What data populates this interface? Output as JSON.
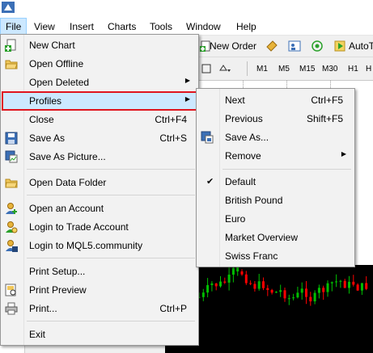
{
  "menubar": {
    "items": [
      {
        "label": "File",
        "active": true
      },
      {
        "label": "View"
      },
      {
        "label": "Insert"
      },
      {
        "label": "Charts"
      },
      {
        "label": "Tools"
      },
      {
        "label": "Window"
      },
      {
        "label": "Help"
      }
    ]
  },
  "toolbar": {
    "new_order_label": "New Order",
    "autotrading_label": "AutoT",
    "timeframes": [
      "M1",
      "M5",
      "M15",
      "M30",
      "H1",
      "H"
    ]
  },
  "file_menu": {
    "items": [
      {
        "label": "New Chart",
        "shortcut": "",
        "icon": "new-chart-icon"
      },
      {
        "label": "Open Offline",
        "shortcut": "",
        "icon": "open-folder-icon"
      },
      {
        "label": "Open Deleted",
        "shortcut": "",
        "submenu": true
      },
      {
        "label": "Profiles",
        "shortcut": "",
        "submenu": true,
        "highlighted": true
      },
      {
        "label": "Close",
        "shortcut": "Ctrl+F4"
      },
      {
        "label": "Save As",
        "shortcut": "Ctrl+S",
        "icon": "save-icon"
      },
      {
        "label": "Save As Picture...",
        "shortcut": "",
        "icon": "save-picture-icon"
      },
      {
        "label": "Open Data Folder",
        "shortcut": "",
        "icon": "data-folder-icon"
      },
      {
        "label": "Open an Account",
        "shortcut": "",
        "icon": "open-account-icon"
      },
      {
        "label": "Login to Trade Account",
        "shortcut": "",
        "icon": "login-trade-icon"
      },
      {
        "label": "Login to MQL5.community",
        "shortcut": "",
        "icon": "mql5-login-icon"
      },
      {
        "label": "Print Setup...",
        "shortcut": ""
      },
      {
        "label": "Print Preview",
        "shortcut": "",
        "icon": "print-preview-icon"
      },
      {
        "label": "Print...",
        "shortcut": "Ctrl+P",
        "icon": "printer-icon"
      },
      {
        "label": "Exit",
        "shortcut": ""
      }
    ]
  },
  "profiles_menu": {
    "items": [
      {
        "label": "Next",
        "shortcut": "Ctrl+F5"
      },
      {
        "label": "Previous",
        "shortcut": "Shift+F5"
      },
      {
        "label": "Save As...",
        "shortcut": "",
        "icon": "save-profile-icon"
      },
      {
        "label": "Remove",
        "shortcut": "",
        "submenu": true
      },
      {
        "label": "Default",
        "shortcut": "",
        "checked": true
      },
      {
        "label": "British Pound",
        "shortcut": ""
      },
      {
        "label": "Euro",
        "shortcut": ""
      },
      {
        "label": "Market Overview",
        "shortcut": ""
      },
      {
        "label": "Swiss Franc",
        "shortcut": ""
      }
    ]
  },
  "colors": {
    "menu_bg": "#f2f2f2",
    "highlight_bg": "#cce8ff",
    "highlight_border": "#e0141e",
    "chart_bg": "#000000",
    "bull_candle": "#00c000",
    "bear_candle": "#ff0000"
  }
}
